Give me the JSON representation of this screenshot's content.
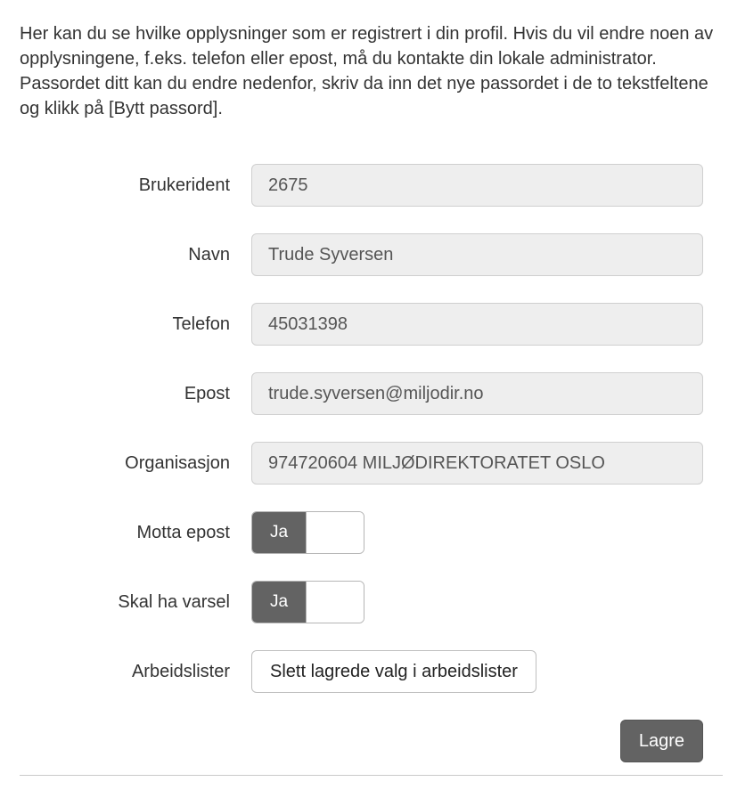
{
  "intro_text": "Her kan du se hvilke opplysninger som er registrert i din profil. Hvis du vil endre noen av opplysningene, f.eks. telefon eller epost, må du kontakte din lokale administrator. Passordet ditt kan du endre nedenfor, skriv da inn det nye passordet i de to tekstfeltene og klikk på [Bytt passord].",
  "labels": {
    "brukerident": "Brukerident",
    "navn": "Navn",
    "telefon": "Telefon",
    "epost": "Epost",
    "organisasjon": "Organisasjon",
    "motta_epost": "Motta epost",
    "skal_ha_varsel": "Skal ha varsel",
    "arbeidslister": "Arbeidslister"
  },
  "values": {
    "brukerident": "2675",
    "navn": "Trude Syversen",
    "telefon": "45031398",
    "epost": "trude.syversen@miljodir.no",
    "organisasjon": "974720604 MILJØDIREKTORATET OSLO"
  },
  "toggles": {
    "motta_epost": "Ja",
    "skal_ha_varsel": "Ja"
  },
  "buttons": {
    "slett_arbeidslister": "Slett lagrede valg i arbeidslister",
    "lagre": "Lagre"
  }
}
